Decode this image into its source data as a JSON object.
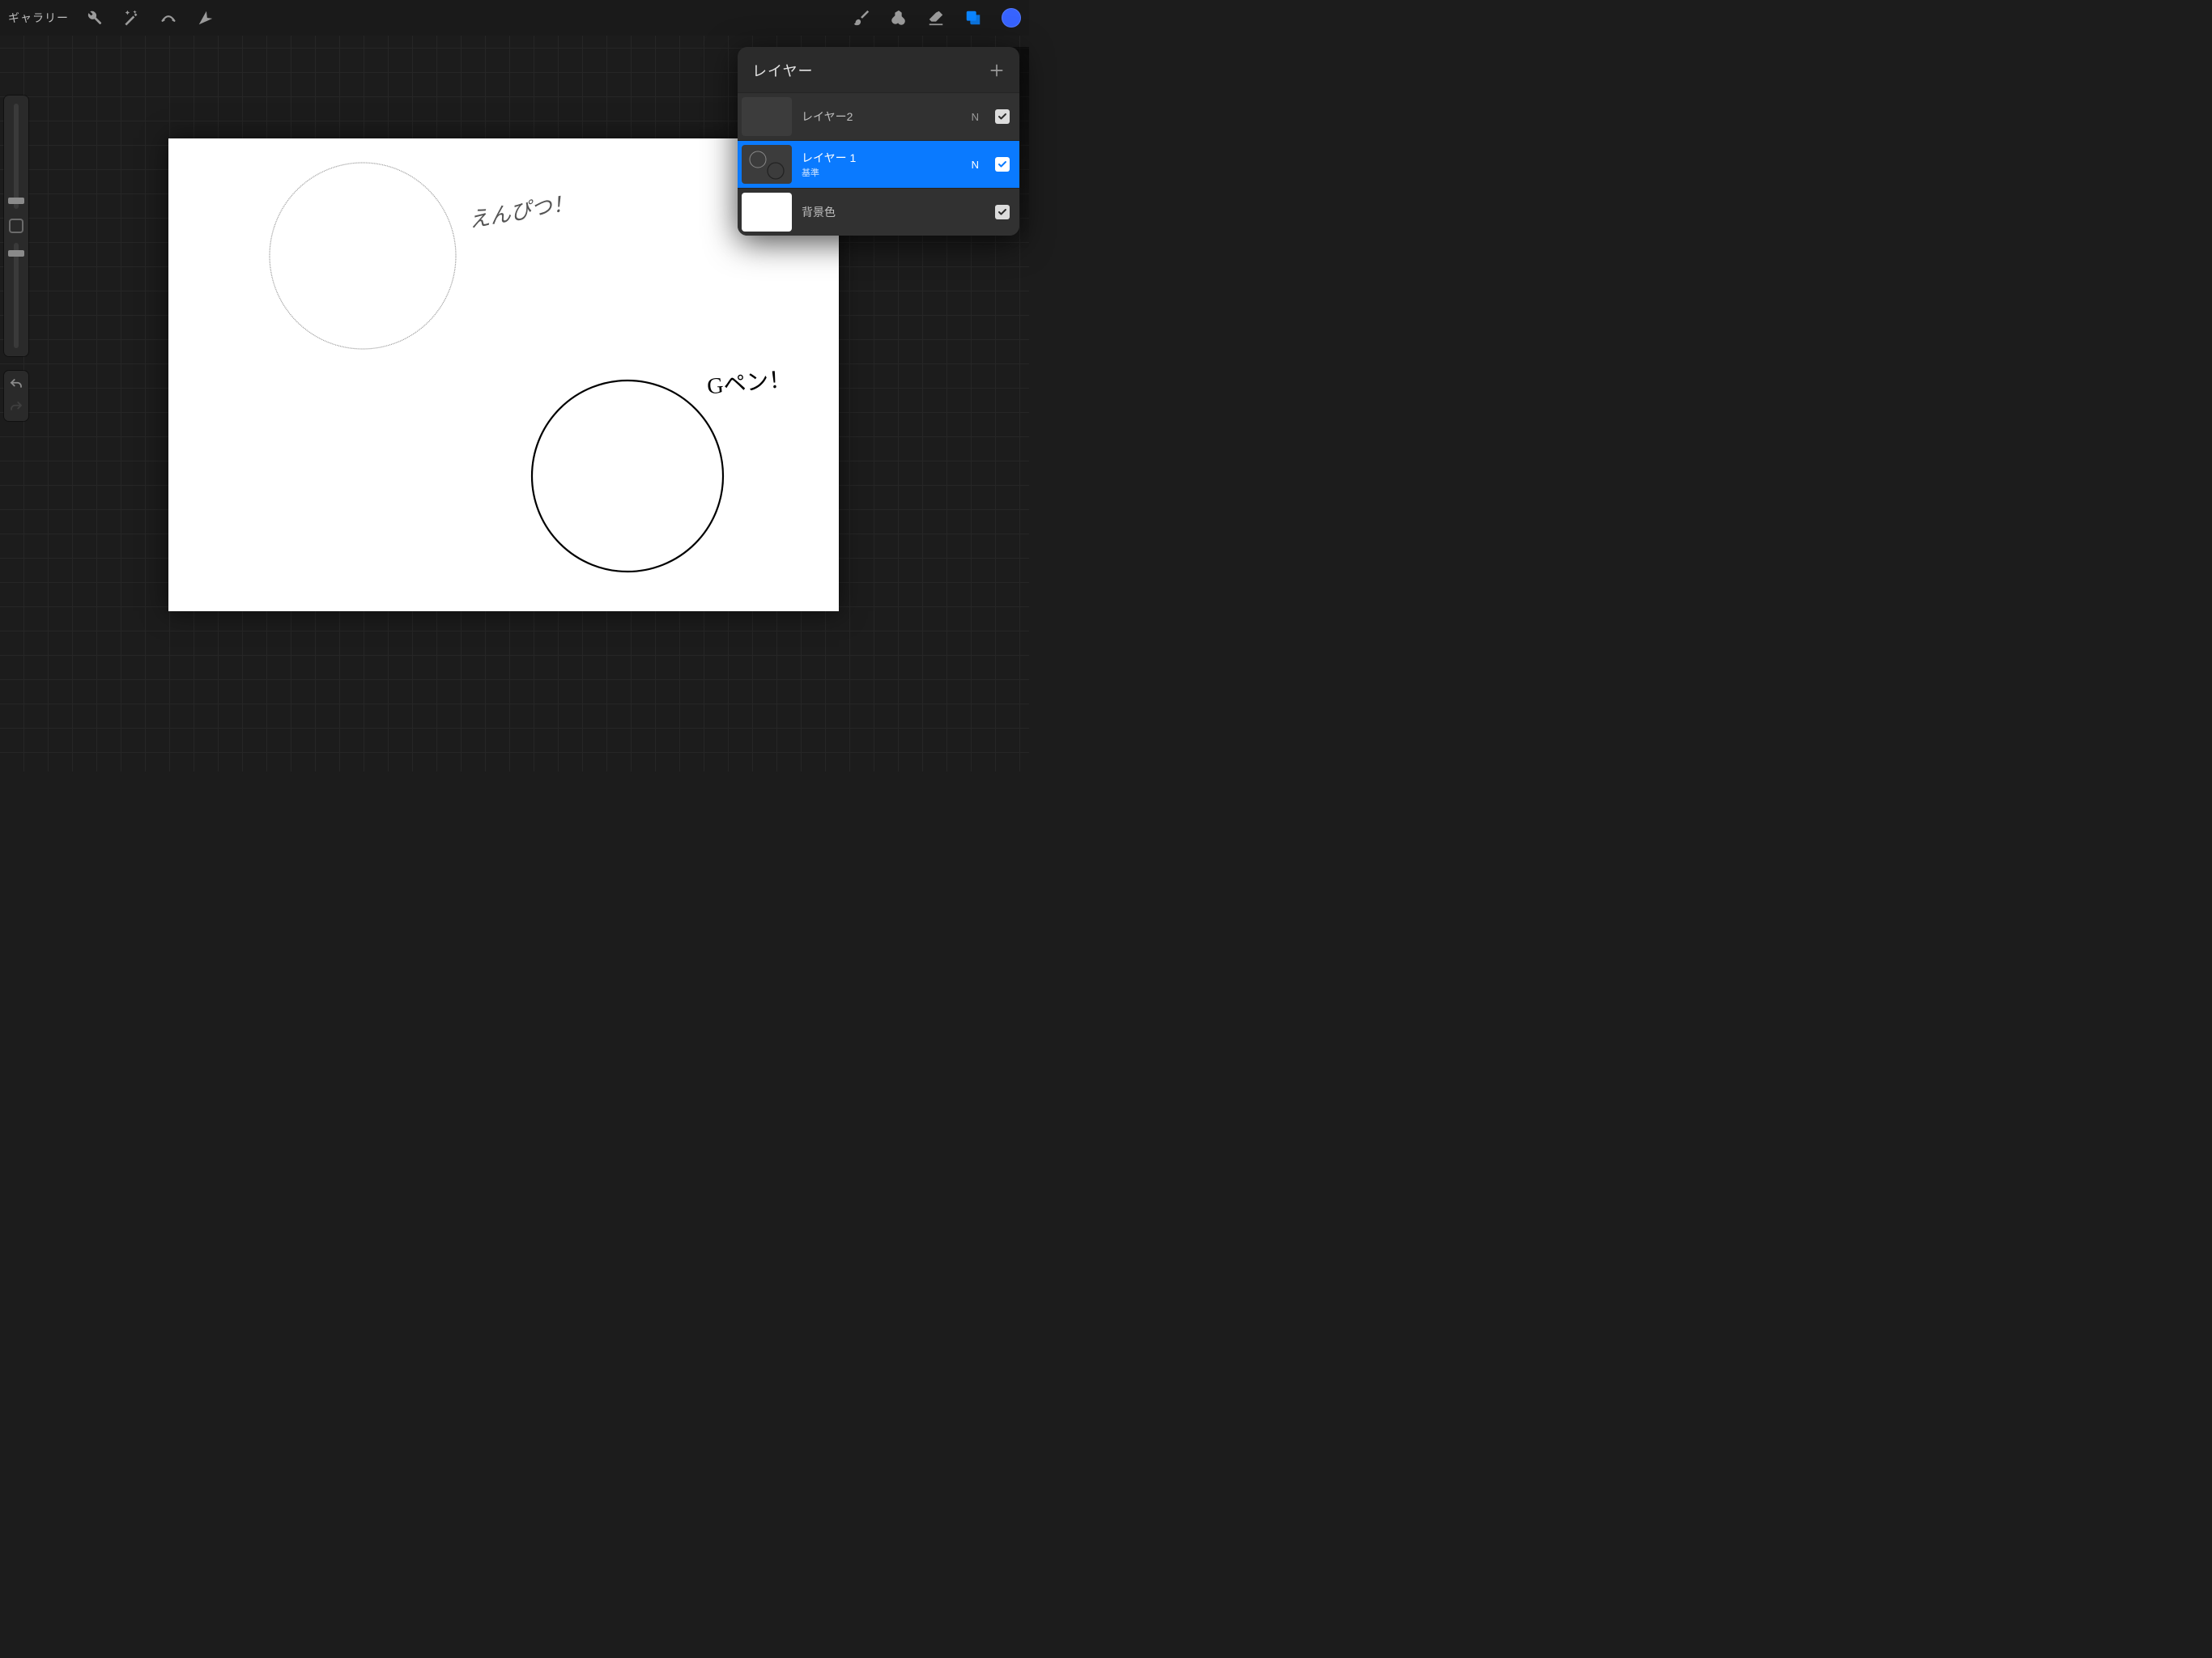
{
  "toolbar": {
    "gallery_label": "ギャラリー",
    "current_color": "#3763ff"
  },
  "canvas": {
    "annotation_pencil": "えんぴつ！",
    "annotation_gpen": "Gペン！"
  },
  "sidebar": {
    "brush_size_handle_pct": 92,
    "opacity_handle_pct": 10
  },
  "layers_panel": {
    "title": "レイヤー",
    "items": [
      {
        "name": "レイヤー2",
        "subtitle": "",
        "blend_letter": "N",
        "visible": true,
        "selected": false,
        "thumb": "empty"
      },
      {
        "name": "レイヤー 1",
        "subtitle": "基準",
        "blend_letter": "N",
        "visible": true,
        "selected": true,
        "thumb": "circles"
      },
      {
        "name": "背景色",
        "subtitle": "",
        "blend_letter": "",
        "visible": true,
        "selected": false,
        "thumb": "white"
      }
    ]
  }
}
